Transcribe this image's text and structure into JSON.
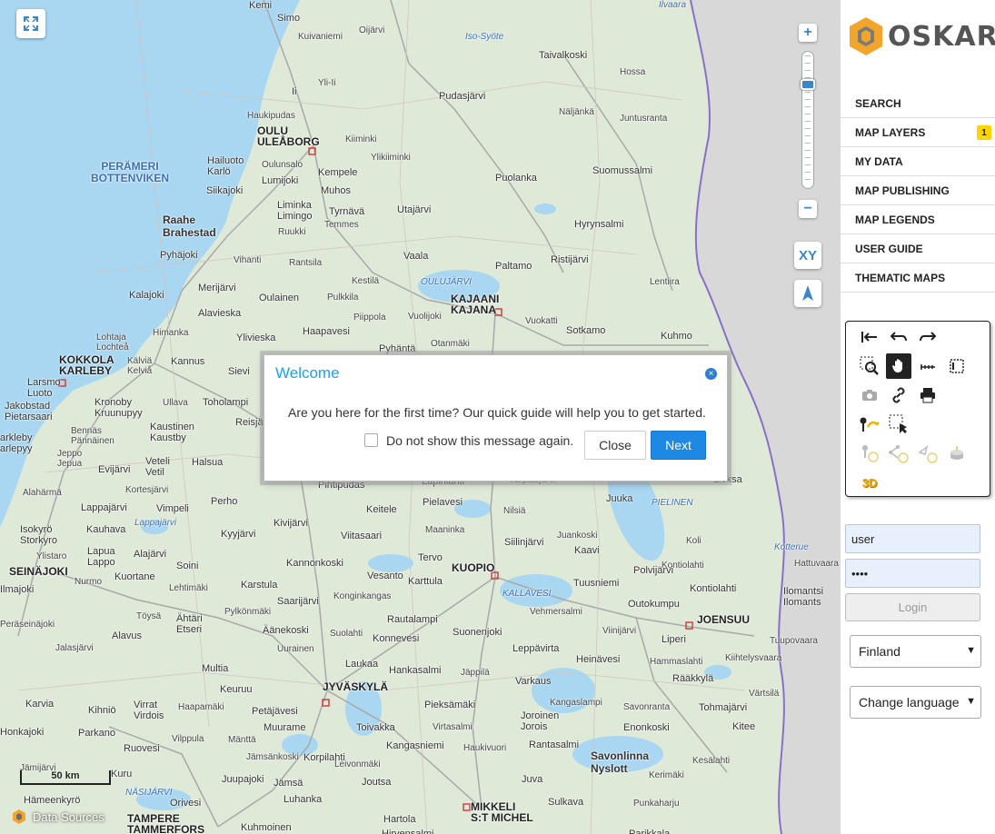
{
  "map": {
    "labels": [
      {
        "t": "Kemi",
        "cls": ""
      },
      {
        "t": "Simo",
        "cls": ""
      },
      {
        "t": "Kuivaniemi",
        "cls": "small"
      },
      {
        "t": "Oijärvi",
        "cls": "small"
      },
      {
        "t": "Taivalkoski",
        "cls": ""
      },
      {
        "t": "Hossa",
        "cls": "small"
      },
      {
        "t": "Pudasjärvi",
        "cls": ""
      },
      {
        "t": "Näljänkä",
        "cls": "small"
      },
      {
        "t": "Juntusranta",
        "cls": "small"
      },
      {
        "t": "Yli-Ii",
        "cls": "small"
      },
      {
        "t": "Ii",
        "cls": ""
      },
      {
        "t": "Haukipudas",
        "cls": "small"
      },
      {
        "t": "OULU\nULEÅBORG",
        "cls": "city"
      },
      {
        "t": "Kiiminki",
        "cls": "small"
      },
      {
        "t": "Ylikiiminki",
        "cls": "small"
      },
      {
        "t": "PERÄMERI\nBOTTENVIKEN",
        "cls": "sea"
      },
      {
        "t": "Hailuoto\nKarlö",
        "cls": ""
      },
      {
        "t": "Oulunsalo",
        "cls": "small"
      },
      {
        "t": "Kempele",
        "cls": ""
      },
      {
        "t": "Puolanka",
        "cls": ""
      },
      {
        "t": "Suomussalmi",
        "cls": ""
      },
      {
        "t": "Lumijoki",
        "cls": ""
      },
      {
        "t": "Siikajoki",
        "cls": ""
      },
      {
        "t": "Muhos",
        "cls": ""
      },
      {
        "t": "Liminka\nLimingo",
        "cls": ""
      },
      {
        "t": "Tyrnävä",
        "cls": ""
      },
      {
        "t": "Utajärvi",
        "cls": ""
      },
      {
        "t": "Hyrynsalmi",
        "cls": ""
      },
      {
        "t": "Raahe\nBrahestad",
        "cls": "big"
      },
      {
        "t": "Temmes",
        "cls": "small"
      },
      {
        "t": "Ruukki",
        "cls": "small"
      },
      {
        "t": "Pyhäjoki",
        "cls": ""
      },
      {
        "t": "Vihanti",
        "cls": "small"
      },
      {
        "t": "Rantsila",
        "cls": "small"
      },
      {
        "t": "Vaala",
        "cls": ""
      },
      {
        "t": "Paltamo",
        "cls": ""
      },
      {
        "t": "Ristijärvi",
        "cls": ""
      },
      {
        "t": "Merijärvi",
        "cls": ""
      },
      {
        "t": "Lentiira",
        "cls": "small"
      },
      {
        "t": "Kalajoki",
        "cls": ""
      },
      {
        "t": "Oulainen",
        "cls": ""
      },
      {
        "t": "Pulkkila",
        "cls": "small"
      },
      {
        "t": "Kestilä",
        "cls": "small"
      },
      {
        "t": "OULUJÄRVI",
        "cls": "lake"
      },
      {
        "t": "KAJAANI\nKAJANA",
        "cls": "city"
      },
      {
        "t": "Alavieska",
        "cls": ""
      },
      {
        "t": "Piippola",
        "cls": "small"
      },
      {
        "t": "Vuolijoki",
        "cls": "small"
      },
      {
        "t": "Vuokatti",
        "cls": "small"
      },
      {
        "t": "Himanka",
        "cls": "small"
      },
      {
        "t": "Ylivieska",
        "cls": ""
      },
      {
        "t": "Haapavesi",
        "cls": ""
      },
      {
        "t": "Sotkamo",
        "cls": ""
      },
      {
        "t": "Kuhmo",
        "cls": ""
      },
      {
        "t": "Lohtaja\nLochteå",
        "cls": "small"
      },
      {
        "t": "Pyhäntä",
        "cls": ""
      },
      {
        "t": "Otanmäki",
        "cls": "small"
      },
      {
        "t": "KOKKOLA\nKARLEBY",
        "cls": "city"
      },
      {
        "t": "Kälviä\nKelviå",
        "cls": "small"
      },
      {
        "t": "Kannus",
        "cls": ""
      },
      {
        "t": "Sievi",
        "cls": ""
      },
      {
        "t": "Larsmo\nLuoto",
        "cls": ""
      },
      {
        "t": "Jakobstad\nPietarsaari",
        "cls": ""
      },
      {
        "t": "Kronoby\nKruunupyy",
        "cls": ""
      },
      {
        "t": "Ullava",
        "cls": "small"
      },
      {
        "t": "Toholampi",
        "cls": ""
      },
      {
        "t": "Reisjärvi",
        "cls": ""
      },
      {
        "t": "Bennäs\nPännäinen",
        "cls": "small"
      },
      {
        "t": "Kaustinen\nKaustby",
        "cls": ""
      },
      {
        "t": "arkleby\narlepyy",
        "cls": ""
      },
      {
        "t": "Jeppo\nJepua",
        "cls": "small"
      },
      {
        "t": "Veteli\nVetil",
        "cls": ""
      },
      {
        "t": "Halsua",
        "cls": ""
      },
      {
        "t": "Evijärvi",
        "cls": ""
      },
      {
        "t": "Pihtipudas",
        "cls": ""
      },
      {
        "t": "Lapinlahti",
        "cls": ""
      },
      {
        "t": "Varpaisjärvi",
        "cls": "small"
      },
      {
        "t": "Lieksa",
        "cls": ""
      },
      {
        "t": "Alahärmä",
        "cls": "small"
      },
      {
        "t": "Kortesjärvi",
        "cls": "small"
      },
      {
        "t": "Perho",
        "cls": ""
      },
      {
        "t": "Pielavesi",
        "cls": ""
      },
      {
        "t": "Juuka",
        "cls": ""
      },
      {
        "t": "PIELINEN",
        "cls": "lake"
      },
      {
        "t": "Lappajärvi",
        "cls": ""
      },
      {
        "t": "Vimpeli",
        "cls": ""
      },
      {
        "t": "Keitele",
        "cls": ""
      },
      {
        "t": "Nilsiä",
        "cls": "small"
      },
      {
        "t": "Isokyrö\nStorkyro",
        "cls": ""
      },
      {
        "t": "Kauhava",
        "cls": ""
      },
      {
        "t": "Lappajärvi",
        "cls": "lake"
      },
      {
        "t": "Kyyjärvi",
        "cls": ""
      },
      {
        "t": "Kivijärvi",
        "cls": ""
      },
      {
        "t": "Viitasaari",
        "cls": ""
      },
      {
        "t": "Maaninka",
        "cls": "small"
      },
      {
        "t": "Juankoski",
        "cls": "small"
      },
      {
        "t": "Siilinjärvi",
        "cls": ""
      },
      {
        "t": "Koli",
        "cls": "small"
      },
      {
        "t": "Ylistaro",
        "cls": "small"
      },
      {
        "t": "Lapua\nLappo",
        "cls": ""
      },
      {
        "t": "Alajärvi",
        "cls": ""
      },
      {
        "t": "Kaavi",
        "cls": ""
      },
      {
        "t": "Kontiolahti",
        "cls": "small"
      },
      {
        "t": "Kannonkoski",
        "cls": ""
      },
      {
        "t": "Tervo",
        "cls": ""
      },
      {
        "t": "Kotterue",
        "cls": "lake"
      },
      {
        "t": "Hattuvaara",
        "cls": "small"
      },
      {
        "t": "SEINÄJOKI",
        "cls": "city"
      },
      {
        "t": "Soini",
        "cls": ""
      },
      {
        "t": "KUOPIO",
        "cls": "city"
      },
      {
        "t": "Polvijärvi",
        "cls": ""
      },
      {
        "t": "Nurmo",
        "cls": "small"
      },
      {
        "t": "Kuortane",
        "cls": ""
      },
      {
        "t": "Vesanto",
        "cls": ""
      },
      {
        "t": "Tuusniemi",
        "cls": ""
      },
      {
        "t": "Kontiolahti",
        "cls": ""
      },
      {
        "t": "Ilomantsi\nIlomants",
        "cls": ""
      },
      {
        "t": "Ilmajoki",
        "cls": ""
      },
      {
        "t": "Lehtimäki",
        "cls": "small"
      },
      {
        "t": "Karstula",
        "cls": ""
      },
      {
        "t": "Karttula",
        "cls": ""
      },
      {
        "t": "KALLAVESI",
        "cls": "lake"
      },
      {
        "t": "Outokumpu",
        "cls": ""
      },
      {
        "t": "Saarijärvi",
        "cls": ""
      },
      {
        "t": "Konginkangas",
        "cls": "small"
      },
      {
        "t": "Vehmersalmi",
        "cls": "small"
      },
      {
        "t": "Töysä",
        "cls": "small"
      },
      {
        "t": "Pylkönmäki",
        "cls": "small"
      },
      {
        "t": "JOENSUU",
        "cls": "city"
      },
      {
        "t": "Peräseinäjoki",
        "cls": "small"
      },
      {
        "t": "Ähtäri\nEtseri",
        "cls": ""
      },
      {
        "t": "Rautalampi",
        "cls": ""
      },
      {
        "t": "Äänekoski",
        "cls": ""
      },
      {
        "t": "Suolahti",
        "cls": "small"
      },
      {
        "t": "Suonenjoki",
        "cls": ""
      },
      {
        "t": "Viinijärvi",
        "cls": "small"
      },
      {
        "t": "Alavus",
        "cls": ""
      },
      {
        "t": "Konnevesi",
        "cls": ""
      },
      {
        "t": "Liperi",
        "cls": ""
      },
      {
        "t": "Tuupovaara",
        "cls": "small"
      },
      {
        "t": "Jalasjärvi",
        "cls": "small"
      },
      {
        "t": "Uurainen",
        "cls": "small"
      },
      {
        "t": "Leppävirta",
        "cls": ""
      },
      {
        "t": "Heinävesi",
        "cls": ""
      },
      {
        "t": "Hammaslahti",
        "cls": "small"
      },
      {
        "t": "Kiihtelysvaara",
        "cls": "small"
      },
      {
        "t": "Multia",
        "cls": ""
      },
      {
        "t": "Laukaa",
        "cls": ""
      },
      {
        "t": "Hankasalmi",
        "cls": ""
      },
      {
        "t": "Jäppilä",
        "cls": "small"
      },
      {
        "t": "Rääkkylä",
        "cls": ""
      },
      {
        "t": "Keuruu",
        "cls": ""
      },
      {
        "t": "JYVÄSKYLÄ",
        "cls": "city"
      },
      {
        "t": "Varkaus",
        "cls": ""
      },
      {
        "t": "Kangaslampi",
        "cls": "small"
      },
      {
        "t": "Värtsilä",
        "cls": "small"
      },
      {
        "t": "Karvia",
        "cls": ""
      },
      {
        "t": "Kihniö",
        "cls": ""
      },
      {
        "t": "Haapamäki",
        "cls": "small"
      },
      {
        "t": "Petäjävesi",
        "cls": ""
      },
      {
        "t": "Pieksämäki",
        "cls": ""
      },
      {
        "t": "Joroinen\nJorois",
        "cls": ""
      },
      {
        "t": "Savonranta",
        "cls": "small"
      },
      {
        "t": "Tohmajärvi",
        "cls": ""
      },
      {
        "t": "Virrat\nVirdois",
        "cls": ""
      },
      {
        "t": "Muurame",
        "cls": ""
      },
      {
        "t": "Toivakka",
        "cls": ""
      },
      {
        "t": "Virtasalmi",
        "cls": "small"
      },
      {
        "t": "Enonkoski",
        "cls": ""
      },
      {
        "t": "Kitee",
        "cls": ""
      },
      {
        "t": "Honkajoki",
        "cls": ""
      },
      {
        "t": "Parkano",
        "cls": ""
      },
      {
        "t": "Vilppula",
        "cls": "small"
      },
      {
        "t": "Mänttä",
        "cls": "small"
      },
      {
        "t": "Korpilahti",
        "cls": ""
      },
      {
        "t": "Kangasniemi",
        "cls": ""
      },
      {
        "t": "Haukivuori",
        "cls": "small"
      },
      {
        "t": "Rantasalmi",
        "cls": ""
      },
      {
        "t": "Ruovesi",
        "cls": ""
      },
      {
        "t": "Jämsänkoski",
        "cls": "small"
      },
      {
        "t": "Savonlinna\nNyslott",
        "cls": "big"
      },
      {
        "t": "Kesälahti",
        "cls": "small"
      },
      {
        "t": "Jämijärvi",
        "cls": "small"
      },
      {
        "t": "Leivonmäki",
        "cls": "small"
      },
      {
        "t": "Kerimäki",
        "cls": "small"
      },
      {
        "t": "Kuru",
        "cls": ""
      },
      {
        "t": "Juupajoki",
        "cls": ""
      },
      {
        "t": "Jämsä",
        "cls": ""
      },
      {
        "t": "Joutsa",
        "cls": ""
      },
      {
        "t": "Juva",
        "cls": ""
      },
      {
        "t": "Hämeenkyrö",
        "cls": ""
      },
      {
        "t": "NÄSIJÄRVI",
        "cls": "lake"
      },
      {
        "t": "Orivesi",
        "cls": ""
      },
      {
        "t": "Luhanka",
        "cls": ""
      },
      {
        "t": "Sulkava",
        "cls": ""
      },
      {
        "t": "Punkaharju",
        "cls": "small"
      },
      {
        "t": "Hartola",
        "cls": ""
      },
      {
        "t": "MIKKELI\nS:T MICHEL",
        "cls": "city"
      },
      {
        "t": "TAMPERE\nTAMMERFORS",
        "cls": "city"
      },
      {
        "t": "Kuhmoinen",
        "cls": ""
      },
      {
        "t": "Hirvensalmi",
        "cls": ""
      },
      {
        "t": "Parikkala",
        "cls": ""
      },
      {
        "t": "Iso-Syöte",
        "cls": "lake"
      },
      {
        "t": "Ilvaara",
        "cls": "lake"
      }
    ],
    "scale_label": "50 km",
    "data_sources": "Data Sources",
    "xy_label": "XY",
    "zoom_level_fraction": 0.85
  },
  "dialog": {
    "title": "Welcome",
    "message": "Are you here for the first time? Our quick guide will help you to get started.",
    "checkbox_label": "Do not show this message again.",
    "close_label": "Close",
    "next_label": "Next"
  },
  "sidebar": {
    "logo_text": "OSKARI",
    "menu": [
      "SEARCH",
      "MAP LAYERS",
      "MY DATA",
      "MAP PUBLISHING",
      "MAP LEGENDS",
      "USER GUIDE",
      "THEMATIC MAPS"
    ],
    "layers_badge": "1",
    "threed_label": "3D",
    "login": {
      "username": "user",
      "password": "••••",
      "button": "Login"
    },
    "country_select": "Finland",
    "language_select": "Change language"
  },
  "colors": {
    "accent": "#1e88e5",
    "title": "#1aa2e6",
    "badge": "#ffd400",
    "land": "#dfe9d8",
    "sea": "#a9d6f0",
    "border": "#8a6fc9"
  }
}
